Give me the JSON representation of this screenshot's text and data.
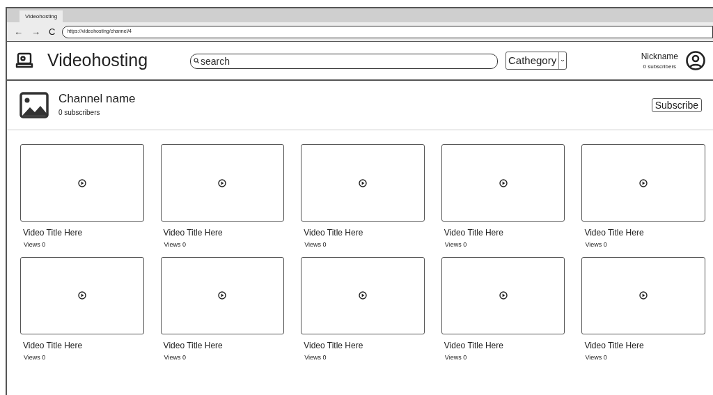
{
  "browser": {
    "tab": "Videohosting",
    "address": "https://videohosting/channel/4",
    "nav": [
      "←",
      "→",
      "C"
    ]
  },
  "header": {
    "logo": "Videohosting",
    "search": {
      "placeholder": "search"
    },
    "category": "Cathegory",
    "user": {
      "name": "Nickname",
      "subscribers": "0 subscribers"
    }
  },
  "channel": {
    "name": "Channel name",
    "subscribers": "0 subscribers",
    "button": "Subscribe"
  },
  "videos": [
    {
      "title": "Video Title Here",
      "views": "Views 0"
    },
    {
      "title": "Video Title Here",
      "views": "Views 0"
    },
    {
      "title": "Video Title Here",
      "views": "Views 0"
    },
    {
      "title": "Video Title Here",
      "views": "Views 0"
    },
    {
      "title": "Video Title Here",
      "views": "Views 0"
    },
    {
      "title": "Video Title Here",
      "views": "Views 0"
    },
    {
      "title": "Video Title Here",
      "views": "Views 0"
    },
    {
      "title": "Video Title Here",
      "views": "Views 0"
    },
    {
      "title": "Video Title Here",
      "views": "Views 0"
    },
    {
      "title": "Video Title Here",
      "views": "Views 0"
    }
  ]
}
